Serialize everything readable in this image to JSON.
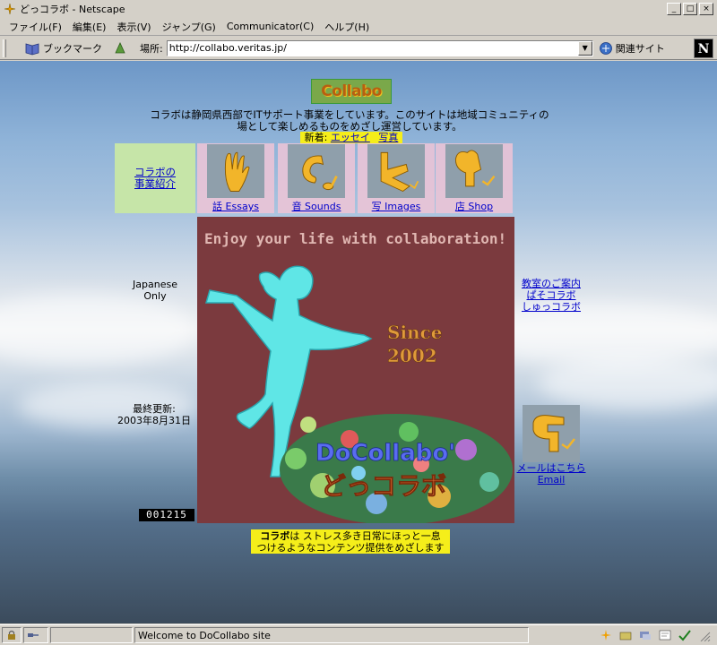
{
  "window": {
    "title": "どっコラボ - Netscape",
    "controls": {
      "minimize": "_",
      "maximize": "□",
      "close": "×"
    }
  },
  "menu": [
    "ファイル(F)",
    "編集(E)",
    "表示(V)",
    "ジャンプ(G)",
    "Communicator(C)",
    "ヘルプ(H)"
  ],
  "location_bar": {
    "bookmarks_label": "ブックマーク",
    "address_label": "場所:",
    "address_value": "http://collabo.veritas.jp/",
    "related_label": "関連サイト",
    "brand_letter": "N"
  },
  "page": {
    "logo_text": "Collabo",
    "intro_line1": "コラボは静岡県西部でITサポート事業をしています。このサイトは地域コミュニティの",
    "intro_line2": "場として楽しめるものをめざし運営しています。",
    "news_label": "新着:",
    "news_link1": "エッセイ",
    "news_link2": "写真",
    "nav_intro_line1": "コラボの",
    "nav_intro_line2": "事業紹介",
    "nav": [
      {
        "label": "話 Essays",
        "icon": "hand-icon"
      },
      {
        "label": "音 Sounds",
        "icon": "note-icon"
      },
      {
        "label": "写 Images",
        "icon": "camera-icon"
      },
      {
        "label": "店 Shop",
        "icon": "shop-icon"
      }
    ],
    "left_note_line1": "Japanese",
    "left_note_line2": "Only",
    "updated_label": "最終更新:",
    "updated_date": "2003年8月31日",
    "counter": "001215",
    "right_links": [
      "教室のご案内",
      "ぱそコラボ",
      "しゅっコラボ"
    ],
    "mail_line1": "メールはこちら",
    "mail_line2": "Email",
    "hero_banner": "Enjoy your life with collaboration!",
    "hero_since": "Since",
    "hero_year": "2002",
    "hero_brand_en": "DoCollabo'",
    "hero_brand_jp": "どっコラボ",
    "tagline_bold": "コラボ",
    "tagline_rest1": "は ストレス多き日常にほっと一息",
    "tagline_line2": "つけるようなコンテンツ提供をめざします"
  },
  "status": {
    "text": "Welcome to DoCollabo site"
  }
}
